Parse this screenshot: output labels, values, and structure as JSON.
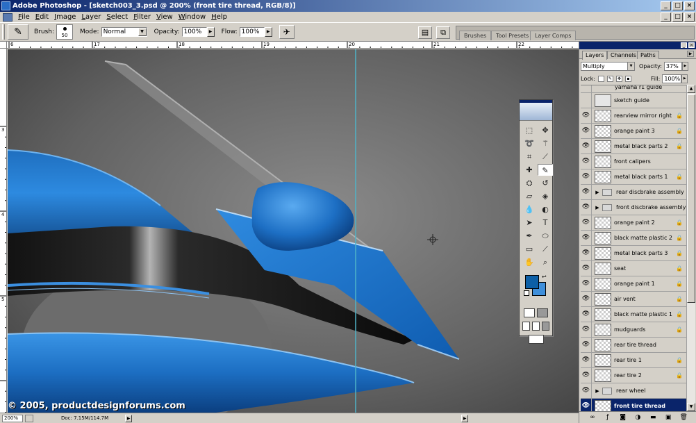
{
  "window": {
    "title": "Adobe Photoshop - [sketch003_3.psd @ 200% (front tire thread, RGB/8)]",
    "controls": [
      "_",
      "□",
      "×"
    ]
  },
  "menu": [
    "File",
    "Edit",
    "Image",
    "Layer",
    "Select",
    "Filter",
    "View",
    "Window",
    "Help"
  ],
  "options_bar": {
    "brush_label": "Brush:",
    "brush_size": "50",
    "mode_label": "Mode:",
    "mode_value": "Normal",
    "opacity_label": "Opacity:",
    "opacity_value": "100%",
    "flow_label": "Flow:",
    "flow_value": "100%"
  },
  "palette_well": {
    "tabs": [
      "Brushes",
      "Tool Presets",
      "Layer Comps"
    ]
  },
  "rulers": {
    "h_labels": [
      "6",
      "17",
      "18",
      "19",
      "20",
      "21",
      "22"
    ],
    "v_labels": [
      "3",
      "4",
      "5"
    ]
  },
  "status": {
    "zoom": "200%",
    "doc": "Doc: 7.15M/114.7M"
  },
  "watermark": "© 2005, productdesignforums.com",
  "layers_palette": {
    "tabs": [
      "Layers",
      "Channels",
      "Paths"
    ],
    "blend_mode": "Multiply",
    "opacity_label": "Opacity:",
    "opacity_value": "37%",
    "lock_label": "Lock:",
    "fill_label": "Fill:",
    "fill_value": "100%",
    "partial_top_layer": "yamaha r1 guide",
    "layers": [
      {
        "name": "sketch guide",
        "visible": false,
        "type": "guide",
        "locked": false
      },
      {
        "name": "rearview mirror right",
        "visible": true,
        "type": "layer",
        "locked": true
      },
      {
        "name": "orange paint 3",
        "visible": true,
        "type": "layer",
        "locked": true
      },
      {
        "name": "metal black parts 2",
        "visible": true,
        "type": "layer",
        "locked": true
      },
      {
        "name": "front calipers",
        "visible": true,
        "type": "layer",
        "locked": false
      },
      {
        "name": "metal black parts 1",
        "visible": true,
        "type": "layer",
        "locked": true
      },
      {
        "name": "rear discbrake assembly",
        "visible": true,
        "type": "group",
        "locked": false
      },
      {
        "name": "front discbrake assembly",
        "visible": true,
        "type": "group",
        "locked": false
      },
      {
        "name": "orange paint 2",
        "visible": true,
        "type": "layer",
        "locked": true
      },
      {
        "name": "black matte plastic 2",
        "visible": true,
        "type": "layer",
        "locked": true
      },
      {
        "name": "metal black parts 3",
        "visible": true,
        "type": "layer",
        "locked": true
      },
      {
        "name": "seat",
        "visible": true,
        "type": "layer",
        "locked": true
      },
      {
        "name": "orange paint 1",
        "visible": true,
        "type": "layer",
        "locked": true
      },
      {
        "name": "air vent",
        "visible": true,
        "type": "layer",
        "locked": true
      },
      {
        "name": "black matte plastic 1",
        "visible": true,
        "type": "layer",
        "locked": true
      },
      {
        "name": "mudguards",
        "visible": true,
        "type": "layer",
        "locked": true
      },
      {
        "name": "rear tire thread",
        "visible": true,
        "type": "layer",
        "locked": false
      },
      {
        "name": "rear tire 1",
        "visible": true,
        "type": "layer",
        "locked": true
      },
      {
        "name": "rear tire 2",
        "visible": true,
        "type": "layer",
        "locked": true
      },
      {
        "name": "rear wheel",
        "visible": true,
        "type": "group",
        "locked": false
      },
      {
        "name": "front tire thread",
        "visible": true,
        "type": "layer",
        "locked": false,
        "selected": true
      }
    ]
  },
  "colors": {
    "foreground": "#0d5fa6",
    "background": "#3f8fdb",
    "title_bar": "#0a246a",
    "chrome": "#d4d0c8",
    "guide_line": "#4fb3c8"
  }
}
